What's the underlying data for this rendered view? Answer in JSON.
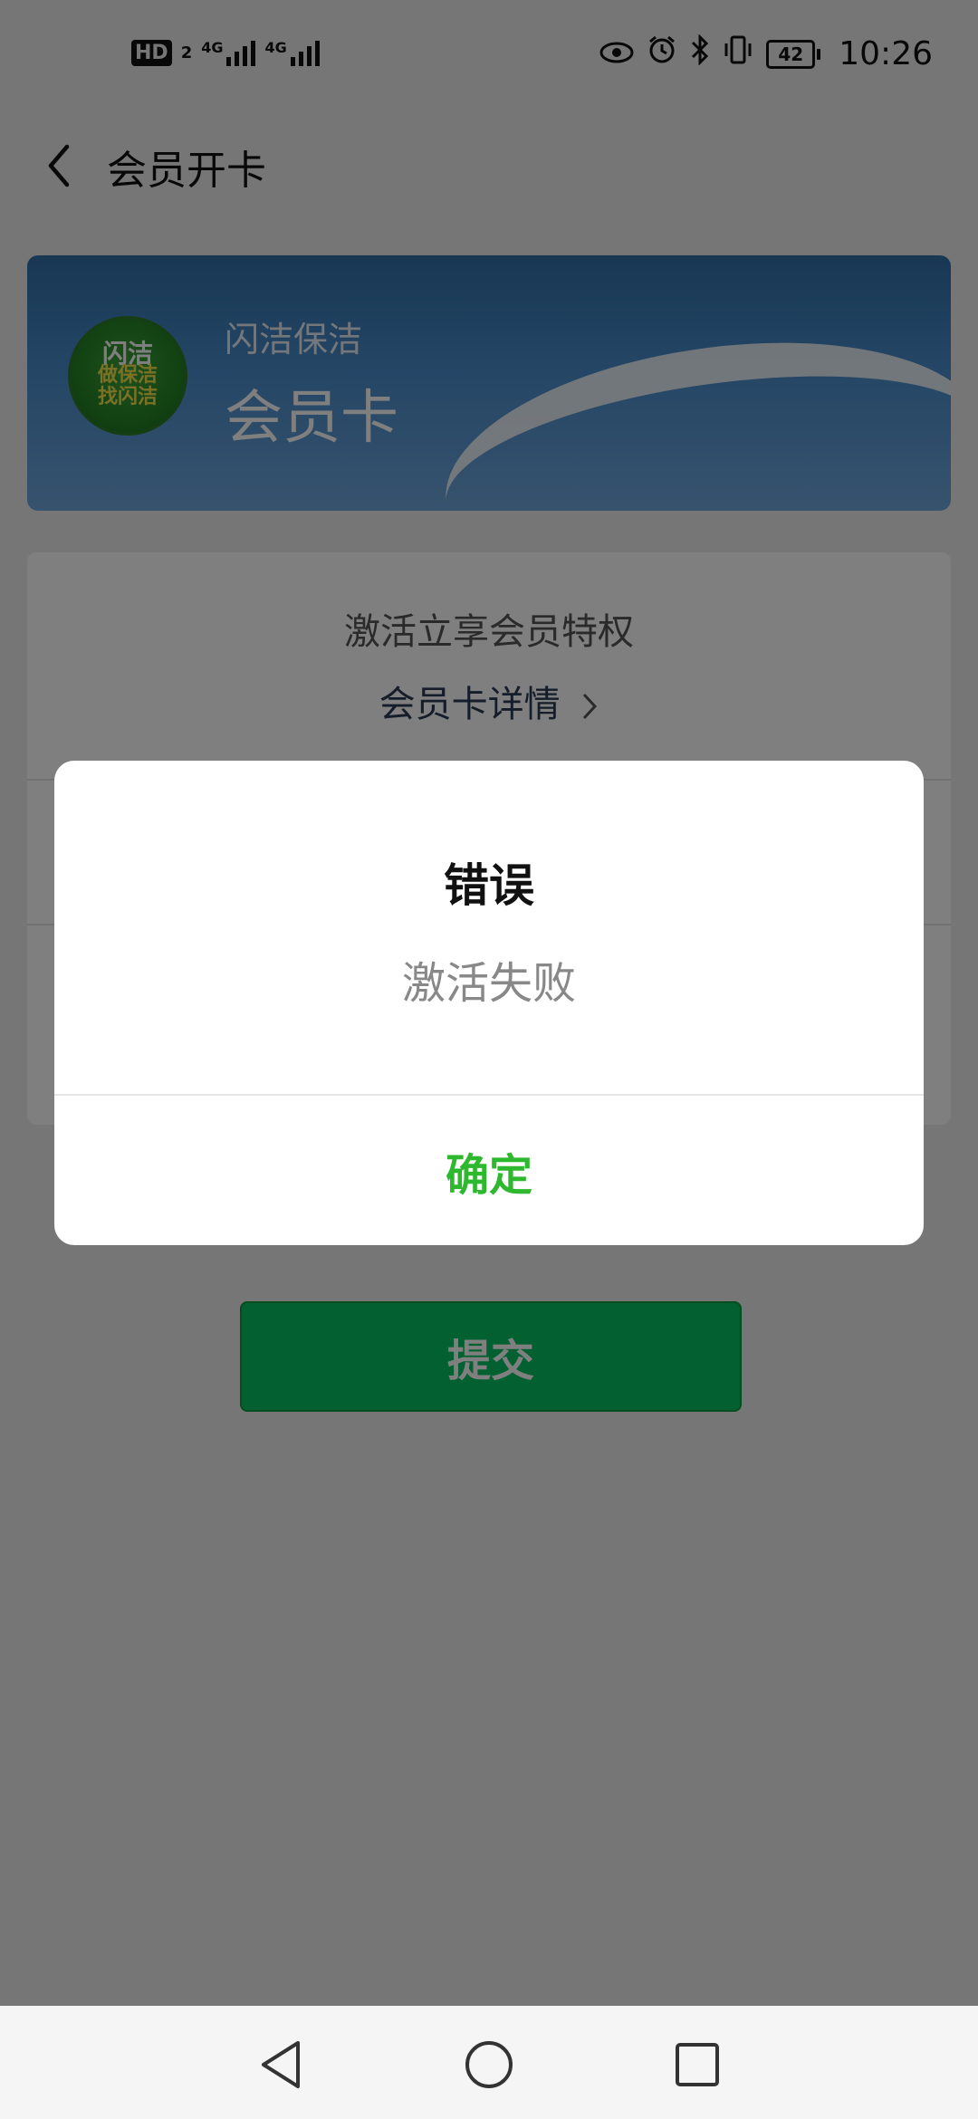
{
  "status_bar": {
    "hd_label": "HD",
    "hd_sub": "2",
    "signal1_label": "4G",
    "signal2_label": "4G",
    "battery_level": "42",
    "time": "10:26",
    "icons": [
      "eye-icon",
      "alarm-icon",
      "bluetooth-icon",
      "vibrate-icon",
      "battery-icon"
    ]
  },
  "header": {
    "title": "会员开卡"
  },
  "card": {
    "brand": "闪洁保洁",
    "name": "会员卡",
    "logo_line1": "闪洁",
    "logo_line2": "做保洁",
    "logo_line3": "找闪洁"
  },
  "panel": {
    "privilege_text": "激活立享会员特权",
    "detail_link": "会员卡详情"
  },
  "submit_label": "提交",
  "dialog": {
    "title": "错误",
    "message": "激活失败",
    "confirm_label": "确定"
  },
  "colors": {
    "accent_green": "#07c160",
    "confirm_green": "#2eb82e"
  }
}
